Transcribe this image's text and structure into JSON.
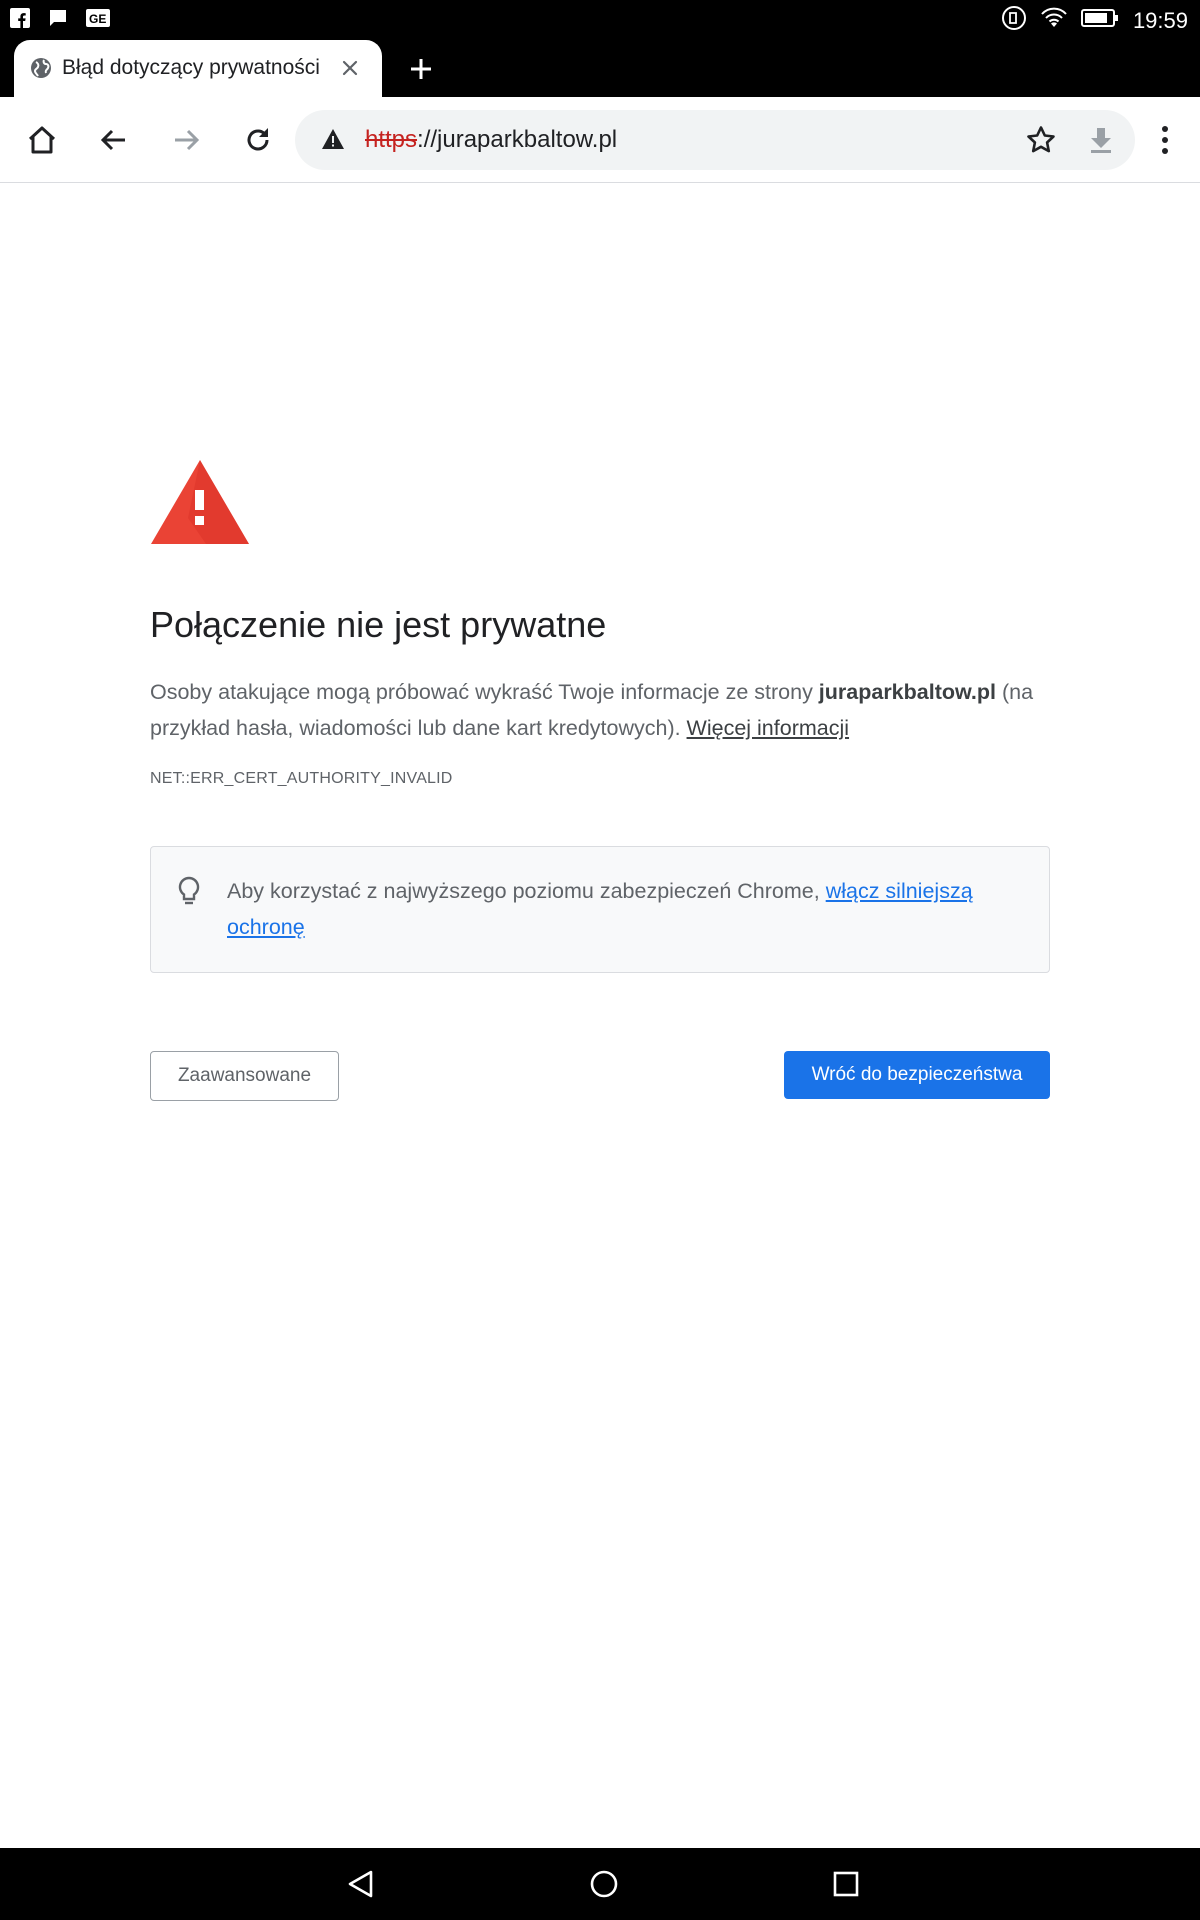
{
  "status_bar": {
    "time": "19:59",
    "left_icons": [
      "facebook-icon",
      "message-icon",
      "news-icon"
    ],
    "right_icons": [
      "nfc-icon",
      "wifi-icon",
      "battery-icon"
    ]
  },
  "tab": {
    "title": "Błąd dotyczący prywatności",
    "favicon": "globe-icon"
  },
  "toolbar": {
    "url_scheme": "https",
    "url_rest": "://juraparkbaltow.pl"
  },
  "interstitial": {
    "heading": "Połączenie nie jest prywatne",
    "explanation_prefix": "Osoby atakujące mogą próbować wykraść Twoje informacje ze strony ",
    "domain": "juraparkbaltow.pl",
    "explanation_suffix": " (na przykład hasła, wiadomości lub dane kart kredytowych). ",
    "learn_more": "Więcej informacji",
    "error_code": "NET::ERR_CERT_AUTHORITY_INVALID",
    "enhanced_text": "Aby korzystać z najwyższego poziomu zabezpieczeń Chrome, ",
    "enhanced_link": "włącz silniejszą ochronę",
    "advanced_button": "Zaawansowane",
    "back_button": "Wróć do bezpieczeństwa"
  },
  "colors": {
    "accent": "#1a73e8",
    "warning_red": "#ea4335",
    "scheme_red": "#c5221f"
  }
}
